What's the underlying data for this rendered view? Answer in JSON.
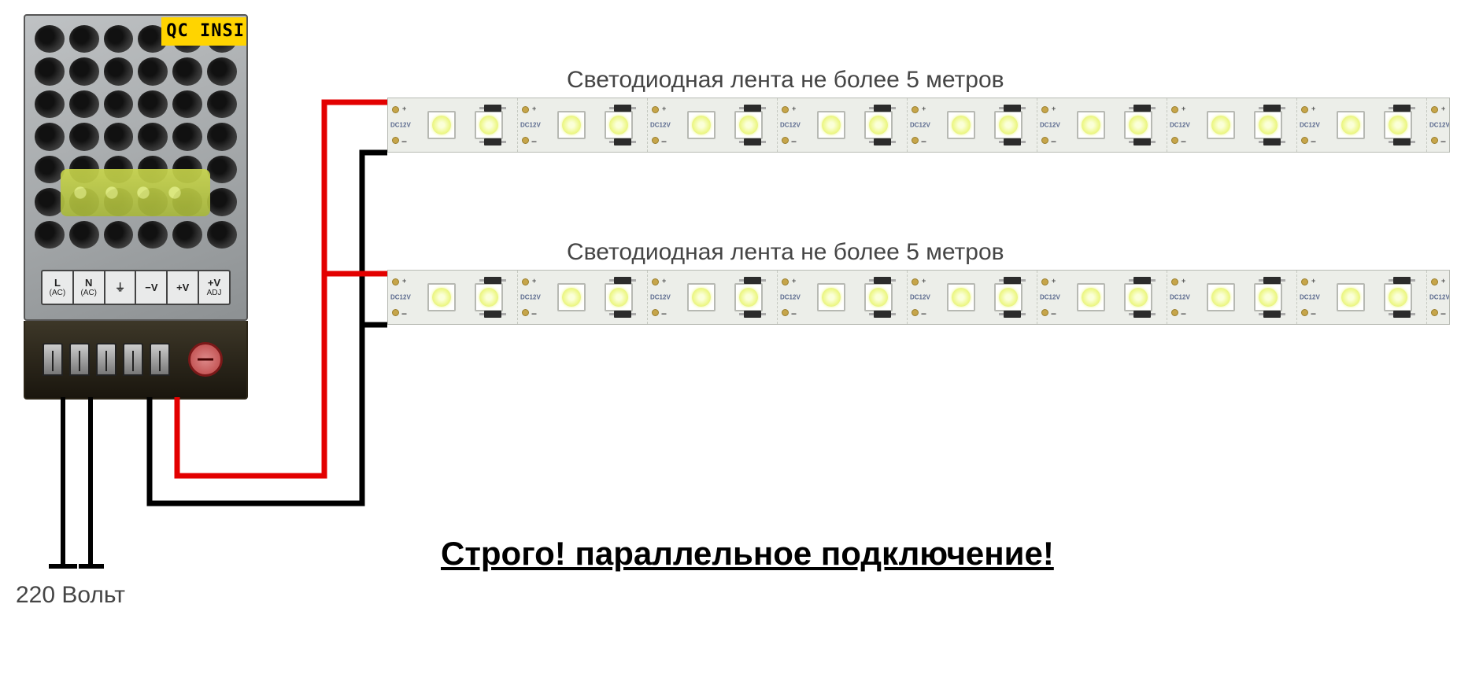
{
  "psu": {
    "qc_label": "QC INSI",
    "terminals": {
      "L": "L",
      "N": "N",
      "AC": "(AC)",
      "GND": "⏚",
      "Vminus": "−V",
      "Vplus": "+V",
      "ADJ": "+V",
      "ADJ_sub": "ADJ"
    }
  },
  "strip_text": {
    "dc": "DC12V",
    "plus": "+",
    "minus": "−"
  },
  "labels": {
    "strip1": "Светодиодная лента не более 5 метров",
    "strip2": "Светодиодная лента не более 5 метров",
    "input": "220 Вольт",
    "warning": "Строго! параллельное подключение!"
  },
  "wires": {
    "positive_color": "#e30000",
    "negative_color": "#000000",
    "input_color": "#000000"
  },
  "diagram": {
    "type": "wiring",
    "source_voltage_V": 220,
    "output_voltage_V": 12,
    "strip_max_length_m": 5,
    "strip_count": 2,
    "connection": "parallel"
  }
}
